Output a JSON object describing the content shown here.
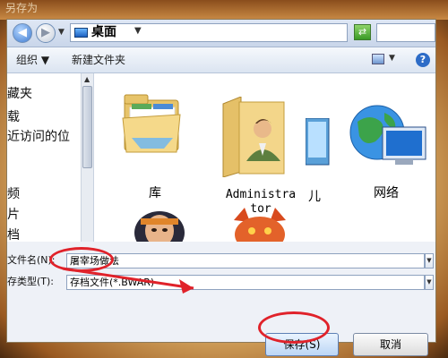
{
  "window": {
    "title": "另存为"
  },
  "nav": {
    "current_location": "桌面"
  },
  "toolbar": {
    "organize": "组织",
    "new_folder": "新建文件夹"
  },
  "left_nav": {
    "items": [
      "藏夹",
      "载",
      "近访问的位",
      "频",
      "片",
      "档"
    ]
  },
  "content": {
    "items": [
      {
        "label": "库",
        "icon": "library-folder-icon"
      },
      {
        "label": "Administra\ntor",
        "icon": "user-folder-icon"
      },
      {
        "label": "儿",
        "icon": "computer-icon"
      },
      {
        "label": "网络",
        "icon": "network-globe-icon"
      }
    ]
  },
  "fields": {
    "filename_label": "文件名(N):",
    "filename_value": "屠宰场做法",
    "filetype_label": "存类型(T):",
    "filetype_value": "存档文件(*.BWAR)"
  },
  "buttons": {
    "save": "保存(S)",
    "cancel": "取消"
  },
  "annotation": {
    "color": "#e0222a"
  }
}
